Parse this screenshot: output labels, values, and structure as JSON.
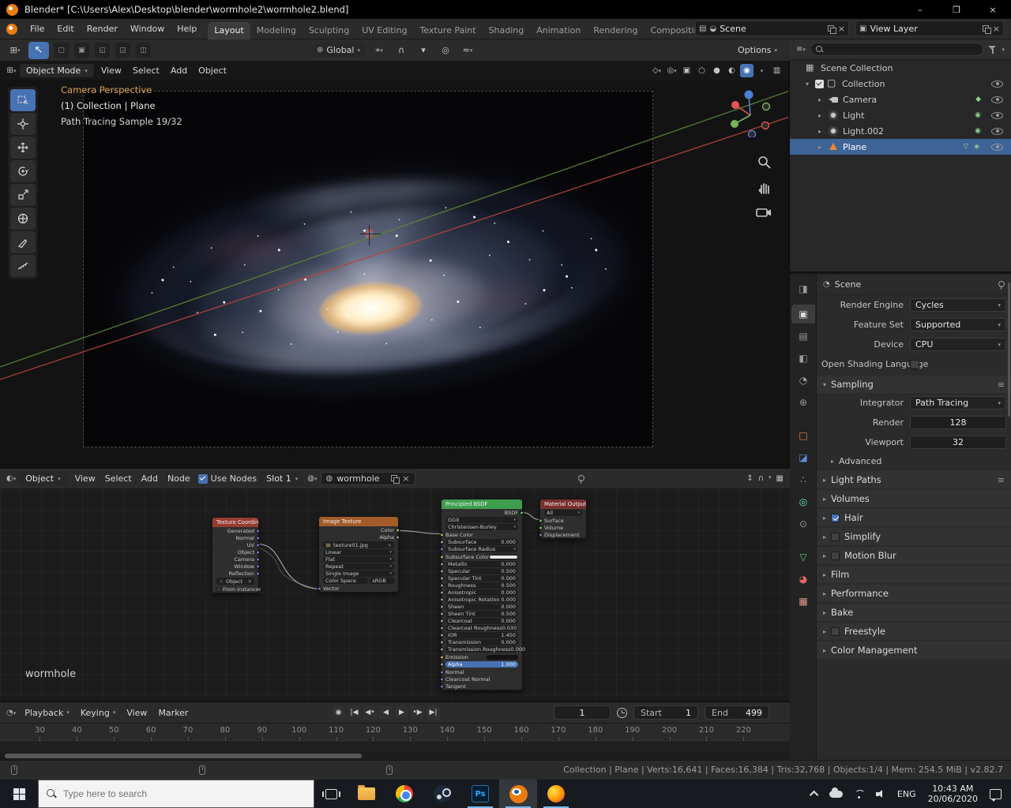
{
  "window": {
    "title": "Blender* [C:\\Users\\Alex\\Desktop\\blender\\wormhole2\\wormhole2.blend]"
  },
  "menubar": {
    "menus": [
      "File",
      "Edit",
      "Render",
      "Window",
      "Help"
    ],
    "workspaces": [
      {
        "label": "Layout",
        "cls": "active"
      },
      {
        "label": "Modeling"
      },
      {
        "label": "Sculpting"
      },
      {
        "label": "UV Editing"
      },
      {
        "label": "Texture Paint"
      },
      {
        "label": "Shading"
      },
      {
        "label": "Animation"
      },
      {
        "label": "Rendering"
      },
      {
        "label": "Compositing"
      }
    ],
    "scene": "Scene",
    "view_layer": "View Layer"
  },
  "tool_settings": {
    "orientation": "Global",
    "options": "Options"
  },
  "viewport": {
    "mode": "Object Mode",
    "menus": [
      "View",
      "Select",
      "Add",
      "Object"
    ],
    "overlay": [
      "Camera Perspective",
      "(1) Collection | Plane",
      "Path Tracing Sample 19/32"
    ]
  },
  "outliner": {
    "rows": [
      {
        "label": "Scene Collection",
        "cls": "d0",
        "arrow": "",
        "icon": "scene"
      },
      {
        "label": "Collection",
        "cls": "d1",
        "arrow": "▾",
        "cb": "show",
        "icon": "collection",
        "eye": "show"
      },
      {
        "label": "Camera",
        "cls": "d2",
        "arrow": "▸",
        "icon": "camera",
        "badge": "camera",
        "eye": "show"
      },
      {
        "label": "Light",
        "cls": "d2",
        "arrow": "▸",
        "icon": "light",
        "badge": "light",
        "eye": "show"
      },
      {
        "label": "Light.002",
        "cls": "d2",
        "arrow": "▸",
        "icon": "light",
        "badge": "light",
        "eye": "show"
      },
      {
        "label": "Plane",
        "cls": "d2 selected",
        "arrow": "▸",
        "icon": "mesh",
        "badge": "mesh",
        "eye": "show"
      }
    ]
  },
  "properties": {
    "breadcrumb": "Scene",
    "fields": [
      {
        "label": "Render Engine",
        "value": "Cycles",
        "w": "dd"
      },
      {
        "label": "Feature Set",
        "value": "Supported",
        "w": "dd"
      },
      {
        "label": "Device",
        "value": "CPU",
        "w": "dd"
      },
      {
        "label": "Open Shading Language",
        "cb": "off"
      }
    ],
    "sampling": {
      "title": "Sampling",
      "rows": [
        {
          "label": "Integrator",
          "value": "Path Tracing",
          "w": "dd"
        },
        {
          "label": "Render",
          "value": "128",
          "w": "num"
        },
        {
          "label": "Viewport",
          "value": "32",
          "w": "num"
        }
      ],
      "advanced": "Advanced"
    },
    "sections": [
      {
        "label": "Light Paths",
        "preset": "show"
      },
      {
        "label": "Volumes"
      },
      {
        "label": "Hair",
        "cb": "on"
      },
      {
        "label": "Simplify",
        "cb": "off"
      },
      {
        "label": "Motion Blur",
        "cb": "off"
      },
      {
        "label": "Film"
      },
      {
        "label": "Performance"
      },
      {
        "label": "Bake"
      },
      {
        "label": "Freestyle",
        "cb": "off"
      },
      {
        "label": "Color Management"
      }
    ]
  },
  "node_editor": {
    "header": {
      "id_type": "Object",
      "menus": [
        "View",
        "Select",
        "Add",
        "Node"
      ],
      "use_nodes": "Use Nodes",
      "slot": "Slot 1",
      "material_name": "wormhole"
    },
    "overlay_label": "wormhole",
    "tex_coord": {
      "title": "Texture Coordinate",
      "outputs": [
        "Generated",
        "Normal",
        "UV",
        "Object",
        "Camera",
        "Window",
        "Reflection"
      ],
      "object_label": "Object",
      "from_instancer": "From Instancer"
    },
    "image": {
      "title": "Image Texture",
      "outputs": [
        {
          "label": "Color",
          "sock": "sy"
        },
        {
          "label": "Alpha",
          "sock": "sg"
        }
      ],
      "filename": "texture01.jpg",
      "interpolation": "Linear",
      "projection": "Flat",
      "extension": "Repeat",
      "source": "Single Image",
      "color_space_label": "Color Space",
      "color_space": "sRGB",
      "vector_label": "Vector"
    },
    "principled": {
      "title": "Principled BSDF",
      "output": "BSDF",
      "rows": [
        {
          "label": "GGX",
          "cls": "dd"
        },
        {
          "label": "Christensen-Burley",
          "cls": "dd"
        },
        {
          "label": "Base Color",
          "cls": "sockrow",
          "sock": "sy"
        },
        {
          "label": "Subsurface",
          "value": "0.000",
          "cls": "val",
          "sock": "sg"
        },
        {
          "label": "Subsurface Radius",
          "cls": "dd",
          "sock": "sv"
        },
        {
          "label": "Subsurface Color",
          "cls": "color cwhite",
          "sock": "sy"
        },
        {
          "label": "Metallic",
          "value": "0.000",
          "cls": "val",
          "sock": "sg"
        },
        {
          "label": "Specular",
          "value": "0.500",
          "cls": "val",
          "sock": "sg"
        },
        {
          "label": "Specular Tint",
          "value": "0.000",
          "cls": "val",
          "sock": "sg"
        },
        {
          "label": "Roughness",
          "value": "0.500",
          "cls": "val",
          "sock": "sg"
        },
        {
          "label": "Anisotropic",
          "value": "0.000",
          "cls": "val",
          "sock": "sg"
        },
        {
          "label": "Anisotropic Rotation",
          "value": "0.000",
          "cls": "val",
          "sock": "sg"
        },
        {
          "label": "Sheen",
          "value": "0.000",
          "cls": "val",
          "sock": "sg"
        },
        {
          "label": "Sheen Tint",
          "value": "0.500",
          "cls": "val",
          "sock": "sg"
        },
        {
          "label": "Clearcoat",
          "value": "0.000",
          "cls": "val",
          "sock": "sg"
        },
        {
          "label": "Clearcoat Roughness",
          "value": "0.030",
          "cls": "val",
          "sock": "sg"
        },
        {
          "label": "IOR",
          "value": "1.450",
          "cls": "val",
          "sock": "sg"
        },
        {
          "label": "Transmission",
          "value": "0.000",
          "cls": "val",
          "sock": "sg"
        },
        {
          "label": "Transmission Roughness",
          "value": "0.000",
          "cls": "val",
          "sock": "sg"
        },
        {
          "label": "Emission",
          "cls": "color cdark",
          "sock": "sy"
        },
        {
          "label": "Alpha",
          "value": "1.000",
          "cls": "val hl",
          "sock": "sg"
        },
        {
          "label": "Normal",
          "cls": "sockrow",
          "sock": "sv"
        },
        {
          "label": "Clearcoat Normal",
          "cls": "sockrow",
          "sock": "sv"
        },
        {
          "label": "Tangent",
          "cls": "sockrow",
          "sock": "sv"
        }
      ]
    },
    "output_node": {
      "title": "Material Output",
      "target": "All",
      "inputs": [
        {
          "label": "Surface",
          "sock": "sgr"
        },
        {
          "label": "Volume",
          "sock": "sgr"
        },
        {
          "label": "Displacement",
          "sock": "sv"
        }
      ]
    }
  },
  "timeline": {
    "menus": [
      {
        "label": "Playback",
        "dd": "dd"
      },
      {
        "label": "Keying",
        "dd": "dd"
      },
      {
        "label": "View"
      },
      {
        "label": "Marker"
      }
    ],
    "frame": "1",
    "start_label": "Start",
    "start": "1",
    "end_label": "End",
    "end": "499",
    "ticks": [
      "30",
      "40",
      "50",
      "60",
      "70",
      "80",
      "90",
      "100",
      "110",
      "120",
      "130",
      "140",
      "150",
      "160",
      "170",
      "180",
      "190",
      "200",
      "210",
      "220"
    ]
  },
  "statusbar": {
    "text": "Collection | Plane | Verts:16,641 | Faces:16,384 | Tris:32,768 | Objects:1/4 | Mem: 254.5 MiB | v2.82.7"
  },
  "taskbar": {
    "search_placeholder": "Type here to search",
    "photoshop_label": "Ps",
    "language": "ENG",
    "time": "10:43 AM",
    "date": "20/06/2020"
  }
}
